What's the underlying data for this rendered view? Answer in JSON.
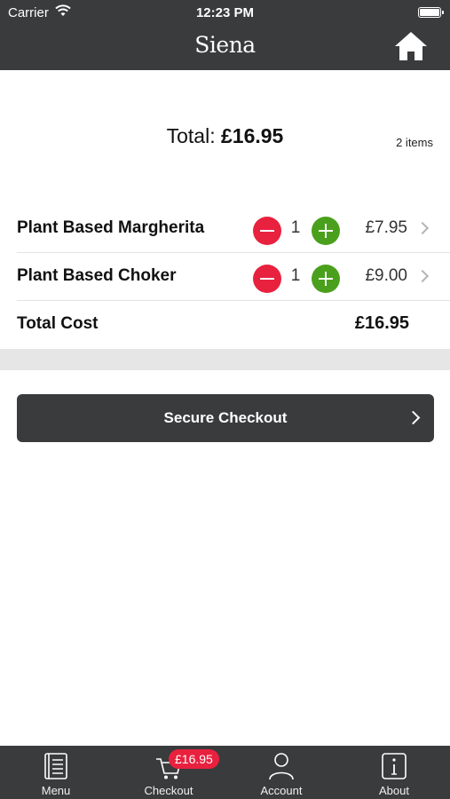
{
  "status_bar": {
    "carrier": "Carrier",
    "time": "12:23 PM"
  },
  "header": {
    "title": "Siena",
    "home_icon": "home-icon"
  },
  "summary": {
    "total_label": "Total:",
    "total_value": "£16.95",
    "item_count": "2 items"
  },
  "cart": {
    "items": [
      {
        "name": "Plant Based Margherita",
        "quantity": "1",
        "price": "£7.95"
      },
      {
        "name": "Plant Based Choker",
        "quantity": "1",
        "price": "£9.00"
      }
    ],
    "total_label": "Total Cost",
    "total_value": "£16.95"
  },
  "checkout_button": {
    "label": "Secure Checkout"
  },
  "tabbar": {
    "tabs": [
      {
        "label": "Menu",
        "icon": "menu-book-icon"
      },
      {
        "label": "Checkout",
        "icon": "cart-icon",
        "badge": "£16.95"
      },
      {
        "label": "Account",
        "icon": "person-icon"
      },
      {
        "label": "About",
        "icon": "info-icon"
      }
    ]
  },
  "colors": {
    "header_bg": "#3a3b3d",
    "minus_button": "#e8213e",
    "plus_button": "#4aa01c",
    "badge": "#e8213e",
    "separator_band": "#e6e6e6"
  }
}
